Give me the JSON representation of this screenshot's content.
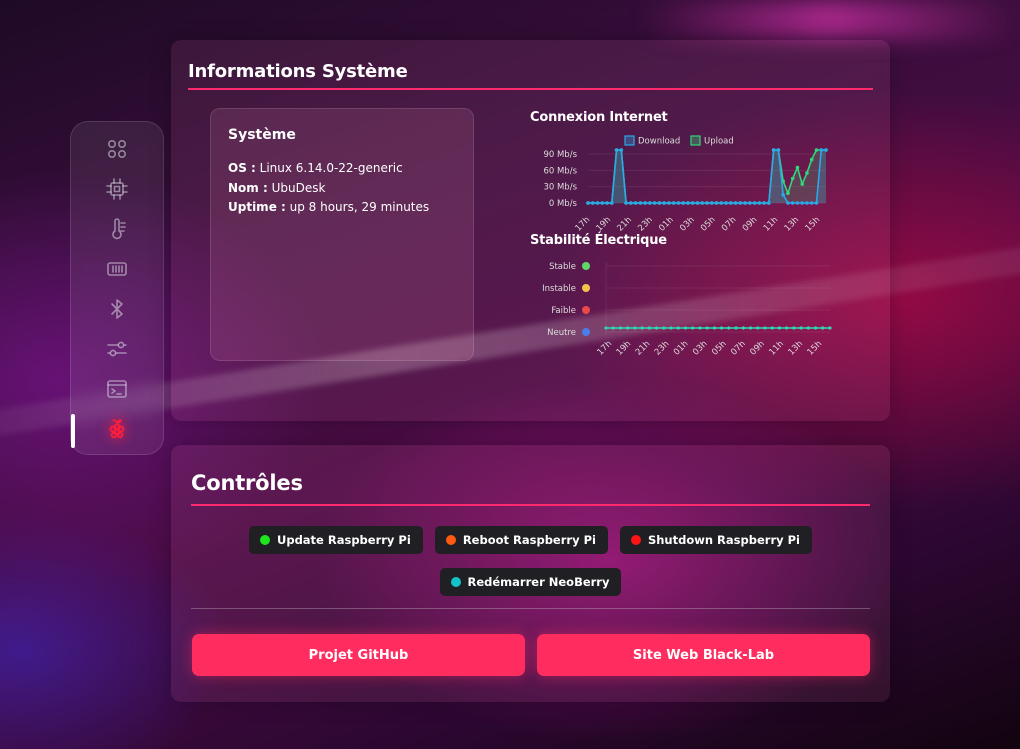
{
  "info_panel": {
    "title": "Informations Système",
    "system": {
      "heading": "Système",
      "os_label": "OS :",
      "os_value": " Linux 6.14.0-22-generic",
      "name_label": "Nom :",
      "name_value": " UbuDesk",
      "uptime_label": "Uptime :",
      "uptime_value": " up 8 hours, 29 minutes"
    }
  },
  "controls_panel": {
    "title": "Contrôles",
    "buttons": [
      {
        "label": "Update Raspberry Pi",
        "dot_color": "#1ee51e"
      },
      {
        "label": "Reboot Raspberry Pi",
        "dot_color": "#ff5a12"
      },
      {
        "label": "Shutdown Raspberry Pi",
        "dot_color": "#ff1414"
      },
      {
        "label": "Redémarrer NeoBerry",
        "dot_color": "#13c2c8"
      }
    ],
    "links": [
      {
        "label": "Projet GitHub"
      },
      {
        "label": "Site Web Black-Lab"
      }
    ]
  },
  "sidebar": {
    "icons": [
      "apps-icon",
      "cpu-icon",
      "thermometer-icon",
      "memory-icon",
      "bluetooth-icon",
      "sliders-icon",
      "terminal-icon",
      "raspberry-icon"
    ],
    "active": "raspberry-icon"
  },
  "colors": {
    "accent": "#ff2d5f",
    "download": "#2aa8e8",
    "upload": "#2fd87a"
  },
  "chart_data": [
    {
      "type": "line",
      "title": "Connexion Internet",
      "categories": [
        "17h",
        "19h",
        "21h",
        "23h",
        "01h",
        "03h",
        "05h",
        "07h",
        "09h",
        "11h",
        "13h",
        "15h"
      ],
      "yticks": [
        "0 Mb/s",
        "30 Mb/s",
        "60 Mb/s",
        "90 Mb/s"
      ],
      "ylim": [
        0,
        100
      ],
      "series": [
        {
          "name": "Download",
          "color": "#2aa8e8",
          "values": [
            0,
            0,
            0,
            0,
            0,
            0,
            100,
            100,
            0,
            0,
            0,
            0,
            0,
            0,
            0,
            0,
            0,
            0,
            0,
            0,
            0,
            0,
            0,
            0,
            0,
            0,
            0,
            0,
            0,
            0,
            0,
            0,
            0,
            0,
            0,
            0,
            0,
            0,
            0,
            100,
            100,
            15,
            0,
            0,
            0,
            0,
            0,
            0,
            0,
            100,
            100
          ]
        },
        {
          "name": "Upload",
          "color": "#2fd87a",
          "values": [
            0,
            0,
            0,
            0,
            0,
            0,
            100,
            100,
            0,
            0,
            0,
            0,
            0,
            0,
            0,
            0,
            0,
            0,
            0,
            0,
            0,
            0,
            0,
            0,
            0,
            0,
            0,
            0,
            0,
            0,
            0,
            0,
            0,
            0,
            0,
            0,
            0,
            0,
            0,
            100,
            100,
            40,
            18,
            45,
            65,
            35,
            55,
            80,
            100,
            100,
            100
          ]
        }
      ],
      "grid": true,
      "legend": "top"
    },
    {
      "type": "line",
      "title": "Stabilité Électrique",
      "categories": [
        "17h",
        "19h",
        "21h",
        "23h",
        "01h",
        "03h",
        "05h",
        "07h",
        "09h",
        "11h",
        "13h",
        "15h"
      ],
      "levels": [
        {
          "label": "Stable",
          "color": "#5fd86a"
        },
        {
          "label": "Instable",
          "color": "#f2c14e"
        },
        {
          "label": "Faible",
          "color": "#e84a4a"
        },
        {
          "label": "Neutre",
          "color": "#4a7de8"
        }
      ],
      "series": [
        {
          "color": "#2fd8b0",
          "level": "Neutre",
          "points": 32
        }
      ],
      "grid": true
    }
  ]
}
